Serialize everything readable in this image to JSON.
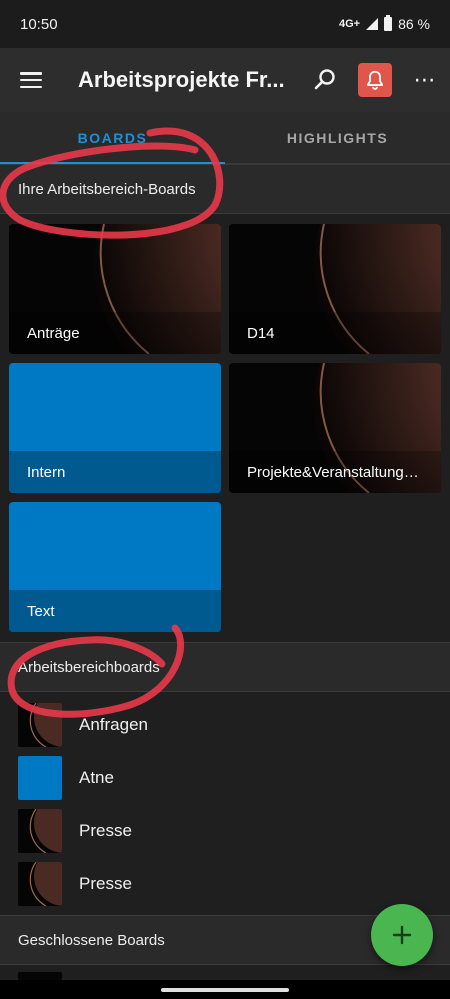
{
  "status_bar": {
    "time": "10:50",
    "network": "4G+",
    "battery": "86 %"
  },
  "app_bar": {
    "title": "Arbeitsprojekte Fr..."
  },
  "tabs": [
    {
      "label": "BOARDS",
      "active": true
    },
    {
      "label": "HIGHLIGHTS",
      "active": false
    }
  ],
  "sections": {
    "workspace_boards": {
      "title": "Ihre Arbeitsbereich-Boards"
    },
    "workspace_list": {
      "title": "Arbeitsbereichboards"
    },
    "closed": {
      "title": "Geschlossene Boards"
    }
  },
  "board_cards": [
    {
      "label": "Anträge",
      "style": "dark"
    },
    {
      "label": "D14",
      "style": "dark"
    },
    {
      "label": "Intern",
      "style": "blue"
    },
    {
      "label": "Projekte&Veranstaltung…",
      "style": "dark"
    },
    {
      "label": "Text",
      "style": "blue"
    }
  ],
  "board_list": [
    {
      "label": "Anfragen",
      "style": "dark"
    },
    {
      "label": "Atne",
      "style": "blue"
    },
    {
      "label": "Presse",
      "style": "dark"
    },
    {
      "label": "Presse",
      "style": "dark"
    }
  ],
  "icons": {
    "menu": "hamburger-icon",
    "search": "search-icon",
    "notifications": "bell-icon",
    "more": "more-dots-icon",
    "add": "plus-icon"
  },
  "colors": {
    "accent": "#1f8fd6",
    "board_blue": "#0079c4",
    "bell_bg": "#e0564a",
    "fab": "#49b64f",
    "annotation": "#e8394a"
  }
}
